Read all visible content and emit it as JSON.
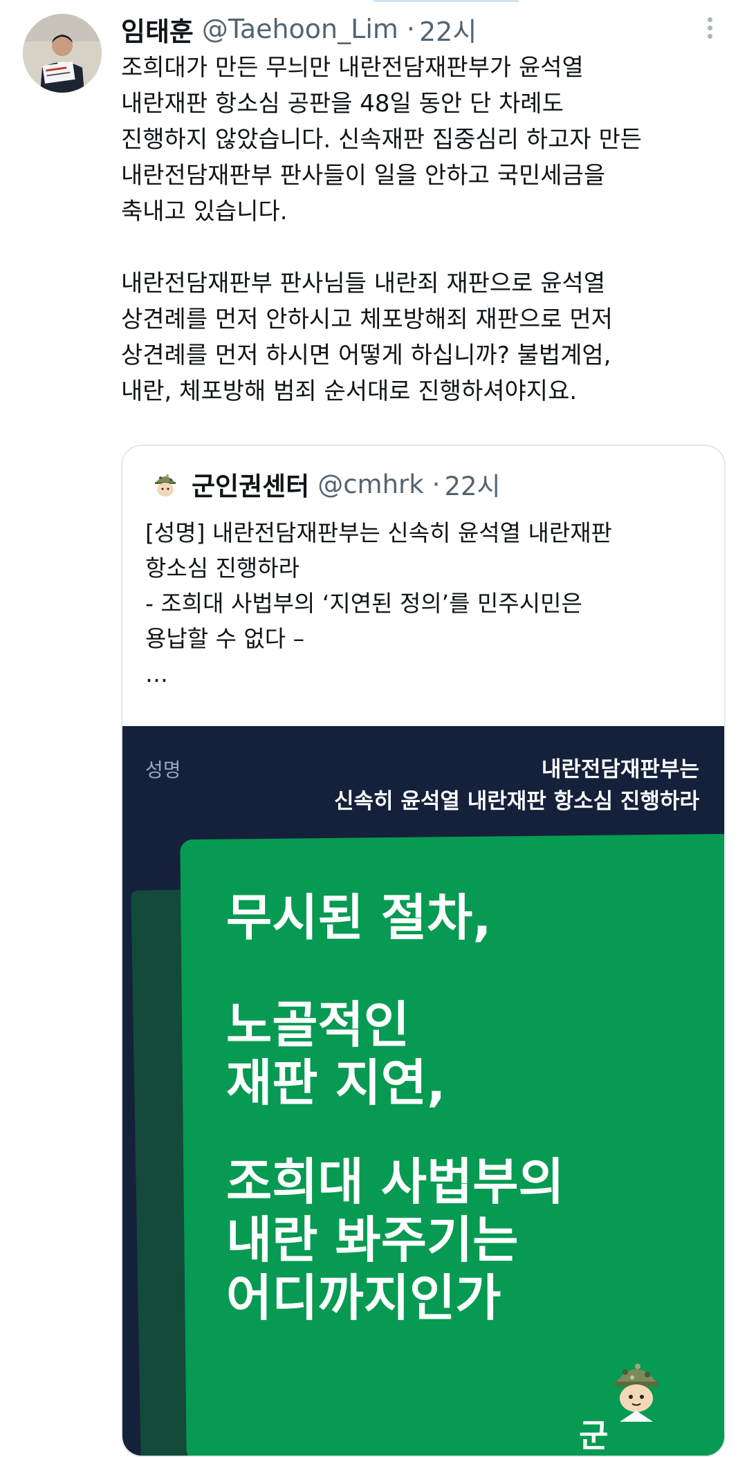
{
  "tweet": {
    "author_name": "임태훈",
    "author_handle": "@Taehoon_Lim",
    "time": "22시",
    "text": "조희대가 만든 무늬만 내란전담재판부가 윤석열\n내란재판 항소심 공판을 48일 동안 단 차례도\n진행하지 않았습니다. 신속재판 집중심리 하고자 만든\n내란전담재판부 판사들이 일을 안하고 국민세금을\n축내고 있습니다.\n\n내란전담재판부 판사님들 내란죄 재판으로 윤석열\n상견례를 먼저 안하시고 체포방해죄 재판으로 먼저\n상견례를 먼저 하시면 어떻게 하십니까? 불법계엄,\n내란, 체포방해 범죄 순서대로 진행하셔야지요.",
    "more_icon": "more-vertical-icon"
  },
  "quote": {
    "author_name": "군인권센터",
    "author_handle": "@cmhrk",
    "time": "22시",
    "text": "[성명] 내란전담재판부는 신속히 윤석열 내란재판\n항소심 진행하라\n- 조희대 사법부의 ‘지연된 정의’를 민주시민은\n용납할 수 없다 –\n…"
  },
  "media": {
    "label": "성명",
    "heading": "내란전담재판부는\n신속히 윤석열 내란재판 항소심 진행하라",
    "big_lines": [
      "무시된 절차,",
      "노골적인\n재판 지연,",
      "조희대 사법부의\n내란 봐주기는\n어디까지인가"
    ],
    "logo_fragment": "군",
    "colors": {
      "navy": "#15203a",
      "green": "#079a52",
      "dark_green": "#134a3a"
    }
  }
}
